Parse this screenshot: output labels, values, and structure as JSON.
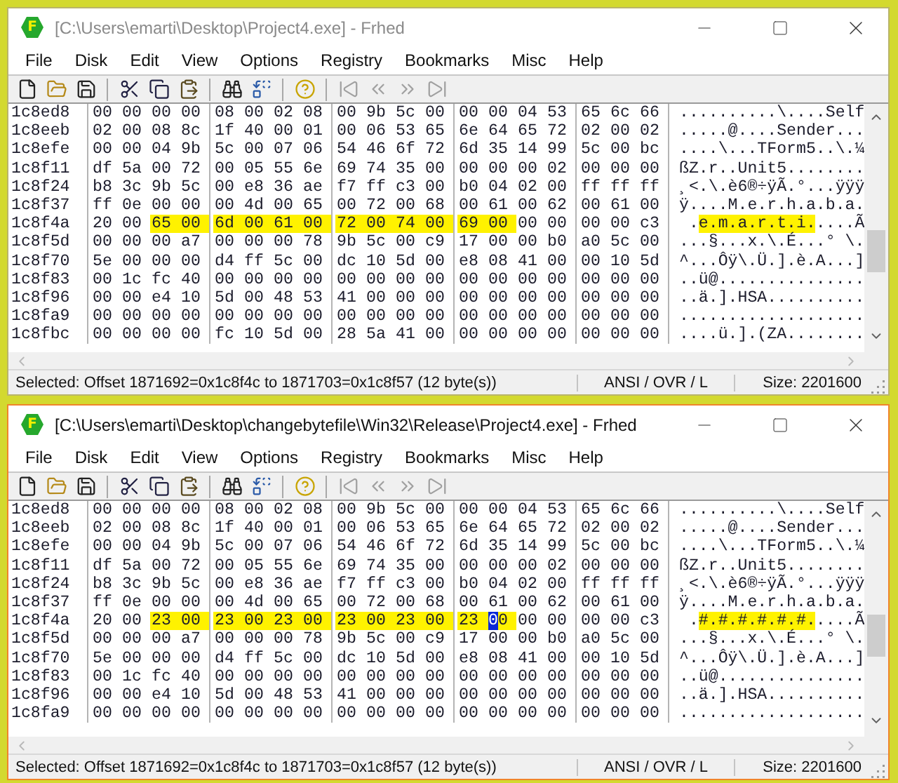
{
  "windows": [
    {
      "title": "[C:\\Users\\emarti\\Desktop\\Project4.exe] - Frhed",
      "active": false,
      "logo_letter": "F",
      "menu": [
        "File",
        "Disk",
        "Edit",
        "View",
        "Options",
        "Registry",
        "Bookmarks",
        "Misc",
        "Help"
      ],
      "rows": [
        {
          "kind": "plain",
          "offset": "1c8ed8",
          "bytes": [
            "00",
            "00",
            "00",
            "00",
            "08",
            "00",
            "02",
            "08",
            "00",
            "9b",
            "5c",
            "00",
            "00",
            "00",
            "04",
            "53",
            "65",
            "6c",
            "66"
          ],
          "ascii": "..........\\....Self"
        },
        {
          "kind": "plain",
          "offset": "1c8eeb",
          "bytes": [
            "02",
            "00",
            "08",
            "8c",
            "1f",
            "40",
            "00",
            "01",
            "00",
            "06",
            "53",
            "65",
            "6e",
            "64",
            "65",
            "72",
            "02",
            "00",
            "02"
          ],
          "ascii": ".....@....Sender..."
        },
        {
          "kind": "plain",
          "offset": "1c8efe",
          "bytes": [
            "00",
            "00",
            "04",
            "9b",
            "5c",
            "00",
            "07",
            "06",
            "54",
            "46",
            "6f",
            "72",
            "6d",
            "35",
            "14",
            "99",
            "5c",
            "00",
            "bc"
          ],
          "ascii": "....\\...TForm5..\\.¼"
        },
        {
          "kind": "plain",
          "offset": "1c8f11",
          "bytes": [
            "df",
            "5a",
            "00",
            "72",
            "00",
            "05",
            "55",
            "6e",
            "69",
            "74",
            "35",
            "00",
            "00",
            "00",
            "00",
            "02",
            "00",
            "00",
            "00"
          ],
          "ascii": "ßZ.r..Unit5........"
        },
        {
          "kind": "plain",
          "offset": "1c8f24",
          "bytes": [
            "b8",
            "3c",
            "9b",
            "5c",
            "00",
            "e8",
            "36",
            "ae",
            "f7",
            "ff",
            "c3",
            "00",
            "b0",
            "04",
            "02",
            "00",
            "ff",
            "ff",
            "ff"
          ],
          "ascii": "¸<.\\.è6®÷ÿÃ.°...ÿÿÿ"
        },
        {
          "kind": "plain",
          "offset": "1c8f37",
          "bytes": [
            "ff",
            "0e",
            "00",
            "00",
            "00",
            "4d",
            "00",
            "65",
            "00",
            "72",
            "00",
            "68",
            "00",
            "61",
            "00",
            "62",
            "00",
            "61",
            "00"
          ],
          "ascii": "ÿ....M.e.r.h.a.b.a."
        },
        {
          "kind": "selection",
          "offset": "1c8f4a",
          "bytes": [
            {
              "text": "20",
              "selected": false,
              "cursor": false
            },
            {
              "text": "00",
              "selected": false,
              "cursor": false
            },
            {
              "text": "65",
              "selected": true,
              "cursor": false
            },
            {
              "text": "00",
              "selected": true,
              "cursor": false
            },
            {
              "text": "6d",
              "selected": true,
              "cursor": false
            },
            {
              "text": "00",
              "selected": true,
              "cursor": false
            },
            {
              "text": "61",
              "selected": true,
              "cursor": false
            },
            {
              "text": "00",
              "selected": true,
              "cursor": false
            },
            {
              "text": "72",
              "selected": true,
              "cursor": false
            },
            {
              "text": "00",
              "selected": true,
              "cursor": false
            },
            {
              "text": "74",
              "selected": true,
              "cursor": false
            },
            {
              "text": "00",
              "selected": true,
              "cursor": false
            },
            {
              "text": "69",
              "selected": true,
              "cursor": false
            },
            {
              "text": "00",
              "selected": true,
              "cursor": false
            },
            {
              "text": "00",
              "selected": false,
              "cursor": false
            },
            {
              "text": "00",
              "selected": false,
              "cursor": false
            },
            {
              "text": "00",
              "selected": false,
              "cursor": false
            },
            {
              "text": "00",
              "selected": false,
              "cursor": false
            },
            {
              "text": "c3",
              "selected": false,
              "cursor": false
            }
          ],
          "ascii": [
            {
              "text": " .",
              "selected": false
            },
            {
              "text": "e.m.a.r.t.i.",
              "selected": true
            },
            {
              "text": "....Ã",
              "selected": false
            }
          ]
        },
        {
          "kind": "plain",
          "offset": "1c8f5d",
          "bytes": [
            "00",
            "00",
            "00",
            "a7",
            "00",
            "00",
            "00",
            "78",
            "9b",
            "5c",
            "00",
            "c9",
            "17",
            "00",
            "00",
            "b0",
            "a0",
            "5c",
            "00"
          ],
          "ascii": "...§...x.\\.É...° \\."
        },
        {
          "kind": "plain",
          "offset": "1c8f70",
          "bytes": [
            "5e",
            "00",
            "00",
            "00",
            "d4",
            "ff",
            "5c",
            "00",
            "dc",
            "10",
            "5d",
            "00",
            "e8",
            "08",
            "41",
            "00",
            "00",
            "10",
            "5d"
          ],
          "ascii": "^...Ôÿ\\.Ü.].è.A...]"
        },
        {
          "kind": "plain",
          "offset": "1c8f83",
          "bytes": [
            "00",
            "1c",
            "fc",
            "40",
            "00",
            "00",
            "00",
            "00",
            "00",
            "00",
            "00",
            "00",
            "00",
            "00",
            "00",
            "00",
            "00",
            "00",
            "00"
          ],
          "ascii": "..ü@..............."
        },
        {
          "kind": "plain",
          "offset": "1c8f96",
          "bytes": [
            "00",
            "00",
            "e4",
            "10",
            "5d",
            "00",
            "48",
            "53",
            "41",
            "00",
            "00",
            "00",
            "00",
            "00",
            "00",
            "00",
            "00",
            "00",
            "00"
          ],
          "ascii": "..ä.].HSA.........."
        },
        {
          "kind": "plain",
          "offset": "1c8fa9",
          "bytes": [
            "00",
            "00",
            "00",
            "00",
            "00",
            "00",
            "00",
            "00",
            "00",
            "00",
            "00",
            "00",
            "00",
            "00",
            "00",
            "00",
            "00",
            "00",
            "00"
          ],
          "ascii": "..................."
        },
        {
          "kind": "plain",
          "offset": "1c8fbc",
          "bytes": [
            "00",
            "00",
            "00",
            "00",
            "fc",
            "10",
            "5d",
            "00",
            "28",
            "5a",
            "41",
            "00",
            "00",
            "00",
            "00",
            "00",
            "00",
            "00",
            "00"
          ],
          "ascii": "....ü.].(ZA........"
        }
      ],
      "status": {
        "selection": "Selected: Offset 1871692=0x1c8f4c to 1871703=0x1c8f57 (12 byte(s))",
        "mode": "ANSI / OVR / L",
        "size": "Size: 2201600"
      }
    },
    {
      "title": "[C:\\Users\\emarti\\Desktop\\changebytefile\\Win32\\Release\\Project4.exe] - Frhed",
      "active": true,
      "logo_letter": "F",
      "menu": [
        "File",
        "Disk",
        "Edit",
        "View",
        "Options",
        "Registry",
        "Bookmarks",
        "Misc",
        "Help"
      ],
      "rows": [
        {
          "kind": "plain",
          "offset": "1c8ed8",
          "bytes": [
            "00",
            "00",
            "00",
            "00",
            "08",
            "00",
            "02",
            "08",
            "00",
            "9b",
            "5c",
            "00",
            "00",
            "00",
            "04",
            "53",
            "65",
            "6c",
            "66"
          ],
          "ascii": "..........\\....Self"
        },
        {
          "kind": "plain",
          "offset": "1c8eeb",
          "bytes": [
            "02",
            "00",
            "08",
            "8c",
            "1f",
            "40",
            "00",
            "01",
            "00",
            "06",
            "53",
            "65",
            "6e",
            "64",
            "65",
            "72",
            "02",
            "00",
            "02"
          ],
          "ascii": ".....@....Sender..."
        },
        {
          "kind": "plain",
          "offset": "1c8efe",
          "bytes": [
            "00",
            "00",
            "04",
            "9b",
            "5c",
            "00",
            "07",
            "06",
            "54",
            "46",
            "6f",
            "72",
            "6d",
            "35",
            "14",
            "99",
            "5c",
            "00",
            "bc"
          ],
          "ascii": "....\\...TForm5..\\.¼"
        },
        {
          "kind": "plain",
          "offset": "1c8f11",
          "bytes": [
            "df",
            "5a",
            "00",
            "72",
            "00",
            "05",
            "55",
            "6e",
            "69",
            "74",
            "35",
            "00",
            "00",
            "00",
            "00",
            "02",
            "00",
            "00",
            "00"
          ],
          "ascii": "ßZ.r..Unit5........"
        },
        {
          "kind": "plain",
          "offset": "1c8f24",
          "bytes": [
            "b8",
            "3c",
            "9b",
            "5c",
            "00",
            "e8",
            "36",
            "ae",
            "f7",
            "ff",
            "c3",
            "00",
            "b0",
            "04",
            "02",
            "00",
            "ff",
            "ff",
            "ff"
          ],
          "ascii": "¸<.\\.è6®÷ÿÃ.°...ÿÿÿ"
        },
        {
          "kind": "plain",
          "offset": "1c8f37",
          "bytes": [
            "ff",
            "0e",
            "00",
            "00",
            "00",
            "4d",
            "00",
            "65",
            "00",
            "72",
            "00",
            "68",
            "00",
            "61",
            "00",
            "62",
            "00",
            "61",
            "00"
          ],
          "ascii": "ÿ....M.e.r.h.a.b.a."
        },
        {
          "kind": "selection",
          "offset": "1c8f4a",
          "bytes": [
            {
              "text": "20",
              "selected": false,
              "cursor": false
            },
            {
              "text": "00",
              "selected": false,
              "cursor": false
            },
            {
              "text": "23",
              "selected": true,
              "cursor": false
            },
            {
              "text": "00",
              "selected": true,
              "cursor": false
            },
            {
              "text": "23",
              "selected": true,
              "cursor": false
            },
            {
              "text": "00",
              "selected": true,
              "cursor": false
            },
            {
              "text": "23",
              "selected": true,
              "cursor": false
            },
            {
              "text": "00",
              "selected": true,
              "cursor": false
            },
            {
              "text": "23",
              "selected": true,
              "cursor": false
            },
            {
              "text": "00",
              "selected": true,
              "cursor": false
            },
            {
              "text": "23",
              "selected": true,
              "cursor": false
            },
            {
              "text": "00",
              "selected": true,
              "cursor": false
            },
            {
              "text": "23",
              "selected": true,
              "cursor": false
            },
            {
              "text": "00",
              "selected": true,
              "cursor": true
            },
            {
              "text": "00",
              "selected": false,
              "cursor": false
            },
            {
              "text": "00",
              "selected": false,
              "cursor": false
            },
            {
              "text": "00",
              "selected": false,
              "cursor": false
            },
            {
              "text": "00",
              "selected": false,
              "cursor": false
            },
            {
              "text": "c3",
              "selected": false,
              "cursor": false
            }
          ],
          "ascii": [
            {
              "text": " .",
              "selected": false
            },
            {
              "text": "#.#.#.#.#.#.",
              "selected": true
            },
            {
              "text": "....Ã",
              "selected": false
            }
          ]
        },
        {
          "kind": "plain",
          "offset": "1c8f5d",
          "bytes": [
            "00",
            "00",
            "00",
            "a7",
            "00",
            "00",
            "00",
            "78",
            "9b",
            "5c",
            "00",
            "c9",
            "17",
            "00",
            "00",
            "b0",
            "a0",
            "5c",
            "00"
          ],
          "ascii": "...§...x.\\.É...° \\."
        },
        {
          "kind": "plain",
          "offset": "1c8f70",
          "bytes": [
            "5e",
            "00",
            "00",
            "00",
            "d4",
            "ff",
            "5c",
            "00",
            "dc",
            "10",
            "5d",
            "00",
            "e8",
            "08",
            "41",
            "00",
            "00",
            "10",
            "5d"
          ],
          "ascii": "^...Ôÿ\\.Ü.].è.A...]"
        },
        {
          "kind": "plain",
          "offset": "1c8f83",
          "bytes": [
            "00",
            "1c",
            "fc",
            "40",
            "00",
            "00",
            "00",
            "00",
            "00",
            "00",
            "00",
            "00",
            "00",
            "00",
            "00",
            "00",
            "00",
            "00",
            "00"
          ],
          "ascii": "..ü@..............."
        },
        {
          "kind": "plain",
          "offset": "1c8f96",
          "bytes": [
            "00",
            "00",
            "e4",
            "10",
            "5d",
            "00",
            "48",
            "53",
            "41",
            "00",
            "00",
            "00",
            "00",
            "00",
            "00",
            "00",
            "00",
            "00",
            "00"
          ],
          "ascii": "..ä.].HSA.........."
        },
        {
          "kind": "plain",
          "offset": "1c8fa9",
          "bytes": [
            "00",
            "00",
            "00",
            "00",
            "00",
            "00",
            "00",
            "00",
            "00",
            "00",
            "00",
            "00",
            "00",
            "00",
            "00",
            "00",
            "00",
            "00",
            "00"
          ],
          "ascii": "..................."
        }
      ],
      "status": {
        "selection": "Selected: Offset 1871692=0x1c8f4c to 1871703=0x1c8f57 (12 byte(s))",
        "mode": "ANSI / OVR / L",
        "size": "Size: 2201600"
      }
    }
  ]
}
